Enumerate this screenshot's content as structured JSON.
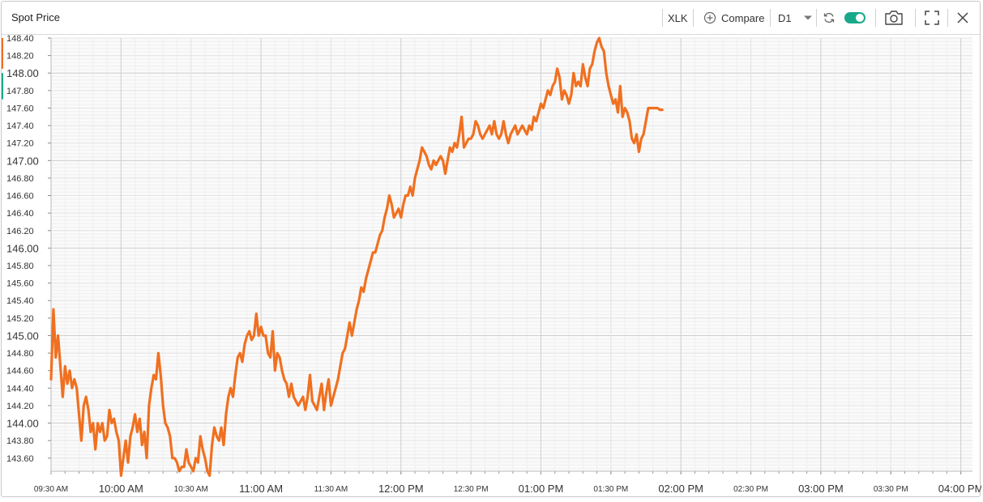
{
  "header": {
    "title": "Spot Price",
    "symbol": "XLK",
    "compare_label": "Compare",
    "timeframe": "D1",
    "toggle_on": true,
    "accent": "#19a98a"
  },
  "chart_data": {
    "type": "line",
    "title": "",
    "xlabel": "",
    "ylabel": "",
    "ylim": [
      143.45,
      148.4
    ],
    "xlim_minutes_from_0930": [
      0,
      395
    ],
    "grid": true,
    "line_color": "#f07020",
    "y_ticks": [
      {
        "v": 143.6,
        "label": "143.60",
        "major": false
      },
      {
        "v": 143.8,
        "label": "143.80",
        "major": false
      },
      {
        "v": 144.0,
        "label": "144.00",
        "major": true
      },
      {
        "v": 144.2,
        "label": "144.20",
        "major": false
      },
      {
        "v": 144.4,
        "label": "144.40",
        "major": false
      },
      {
        "v": 144.6,
        "label": "144.60",
        "major": false
      },
      {
        "v": 144.8,
        "label": "144.80",
        "major": false
      },
      {
        "v": 145.0,
        "label": "145.00",
        "major": true
      },
      {
        "v": 145.2,
        "label": "145.20",
        "major": false
      },
      {
        "v": 145.4,
        "label": "145.40",
        "major": false
      },
      {
        "v": 145.6,
        "label": "145.60",
        "major": false
      },
      {
        "v": 145.8,
        "label": "145.80",
        "major": false
      },
      {
        "v": 146.0,
        "label": "146.00",
        "major": true
      },
      {
        "v": 146.2,
        "label": "146.20",
        "major": false
      },
      {
        "v": 146.4,
        "label": "146.40",
        "major": false
      },
      {
        "v": 146.6,
        "label": "146.60",
        "major": false
      },
      {
        "v": 146.8,
        "label": "146.80",
        "major": false
      },
      {
        "v": 147.0,
        "label": "147.00",
        "major": true
      },
      {
        "v": 147.2,
        "label": "147.20",
        "major": false
      },
      {
        "v": 147.4,
        "label": "147.40",
        "major": false
      },
      {
        "v": 147.6,
        "label": "147.60",
        "major": false
      },
      {
        "v": 147.8,
        "label": "147.80",
        "major": false
      },
      {
        "v": 148.0,
        "label": "148.00",
        "major": true
      },
      {
        "v": 148.2,
        "label": "148.20",
        "major": false
      },
      {
        "v": 148.4,
        "label": "148.40",
        "major": false
      }
    ],
    "x_ticks": [
      {
        "t": 0,
        "label": "09:30 AM",
        "major": false
      },
      {
        "t": 30,
        "label": "10:00 AM",
        "major": true
      },
      {
        "t": 60,
        "label": "10:30 AM",
        "major": false
      },
      {
        "t": 90,
        "label": "11:00 AM",
        "major": true
      },
      {
        "t": 120,
        "label": "11:30 AM",
        "major": false
      },
      {
        "t": 150,
        "label": "12:00 PM",
        "major": true
      },
      {
        "t": 180,
        "label": "12:30 PM",
        "major": false
      },
      {
        "t": 210,
        "label": "01:00 PM",
        "major": true
      },
      {
        "t": 240,
        "label": "01:30 PM",
        "major": false
      },
      {
        "t": 270,
        "label": "02:00 PM",
        "major": true
      },
      {
        "t": 300,
        "label": "02:30 PM",
        "major": false
      },
      {
        "t": 330,
        "label": "03:00 PM",
        "major": true
      },
      {
        "t": 360,
        "label": "03:30 PM",
        "major": false
      },
      {
        "t": 390,
        "label": "04:00 PM",
        "major": true
      }
    ],
    "series": [
      {
        "values": [
          [
            0,
            144.5
          ],
          [
            1,
            145.3
          ],
          [
            2,
            144.75
          ],
          [
            3,
            145.0
          ],
          [
            4,
            144.65
          ],
          [
            5,
            144.3
          ],
          [
            6,
            144.65
          ],
          [
            7,
            144.45
          ],
          [
            8,
            144.6
          ],
          [
            9,
            144.4
          ],
          [
            10,
            144.5
          ],
          [
            11,
            144.4
          ],
          [
            12,
            144.1
          ],
          [
            13,
            143.8
          ],
          [
            14,
            144.2
          ],
          [
            15,
            144.3
          ],
          [
            16,
            144.15
          ],
          [
            17,
            143.9
          ],
          [
            18,
            144.0
          ],
          [
            19,
            143.7
          ],
          [
            20,
            144.0
          ],
          [
            21,
            143.9
          ],
          [
            22,
            144.0
          ],
          [
            23,
            143.8
          ],
          [
            24,
            143.85
          ],
          [
            25,
            144.15
          ],
          [
            26,
            144.0
          ],
          [
            27,
            144.05
          ],
          [
            28,
            143.9
          ],
          [
            29,
            143.8
          ],
          [
            30,
            143.4
          ],
          [
            31,
            143.6
          ],
          [
            32,
            143.8
          ],
          [
            33,
            143.55
          ],
          [
            34,
            143.85
          ],
          [
            35,
            143.95
          ],
          [
            36,
            144.1
          ],
          [
            37,
            143.9
          ],
          [
            38,
            144.05
          ],
          [
            39,
            143.75
          ],
          [
            40,
            143.9
          ],
          [
            41,
            143.6
          ],
          [
            42,
            144.2
          ],
          [
            43,
            144.4
          ],
          [
            44,
            144.55
          ],
          [
            45,
            144.5
          ],
          [
            46,
            144.8
          ],
          [
            47,
            144.55
          ],
          [
            48,
            144.2
          ],
          [
            49,
            144.0
          ],
          [
            50,
            143.95
          ],
          [
            51,
            143.85
          ],
          [
            52,
            143.6
          ],
          [
            53,
            143.6
          ],
          [
            54,
            143.55
          ],
          [
            55,
            143.45
          ],
          [
            56,
            143.5
          ],
          [
            57,
            143.5
          ],
          [
            58,
            143.7
          ],
          [
            59,
            143.55
          ],
          [
            60,
            143.5
          ],
          [
            61,
            143.45
          ],
          [
            62,
            143.6
          ],
          [
            63,
            143.55
          ],
          [
            64,
            143.85
          ],
          [
            65,
            143.7
          ],
          [
            66,
            143.6
          ],
          [
            67,
            143.45
          ],
          [
            68,
            143.4
          ],
          [
            69,
            143.75
          ],
          [
            70,
            143.95
          ],
          [
            71,
            143.85
          ],
          [
            72,
            143.8
          ],
          [
            73,
            143.95
          ],
          [
            74,
            143.75
          ],
          [
            75,
            144.1
          ],
          [
            76,
            144.3
          ],
          [
            77,
            144.4
          ],
          [
            78,
            144.3
          ],
          [
            79,
            144.55
          ],
          [
            80,
            144.75
          ],
          [
            81,
            144.8
          ],
          [
            82,
            144.7
          ],
          [
            83,
            144.9
          ],
          [
            84,
            145.0
          ],
          [
            85,
            145.05
          ],
          [
            86,
            144.95
          ],
          [
            87,
            145.0
          ],
          [
            88,
            145.25
          ],
          [
            89,
            145.0
          ],
          [
            90,
            145.1
          ],
          [
            91,
            145.0
          ],
          [
            92,
            145.0
          ],
          [
            93,
            144.8
          ],
          [
            94,
            144.75
          ],
          [
            95,
            145.05
          ],
          [
            96,
            144.6
          ],
          [
            97,
            144.8
          ],
          [
            98,
            144.75
          ],
          [
            99,
            144.6
          ],
          [
            100,
            144.5
          ],
          [
            101,
            144.45
          ],
          [
            102,
            144.3
          ],
          [
            103,
            144.45
          ],
          [
            104,
            144.3
          ],
          [
            105,
            144.25
          ],
          [
            106,
            144.2
          ],
          [
            107,
            144.25
          ],
          [
            108,
            144.3
          ],
          [
            109,
            144.15
          ],
          [
            110,
            144.3
          ],
          [
            111,
            144.55
          ],
          [
            112,
            144.25
          ],
          [
            113,
            144.2
          ],
          [
            114,
            144.15
          ],
          [
            115,
            144.3
          ],
          [
            116,
            144.45
          ],
          [
            117,
            144.15
          ],
          [
            118,
            144.35
          ],
          [
            119,
            144.5
          ],
          [
            120,
            144.2
          ],
          [
            121,
            144.3
          ],
          [
            122,
            144.4
          ],
          [
            123,
            144.5
          ],
          [
            124,
            144.65
          ],
          [
            125,
            144.8
          ],
          [
            126,
            144.85
          ],
          [
            127,
            145.0
          ],
          [
            128,
            145.15
          ],
          [
            129,
            145.0
          ],
          [
            130,
            145.15
          ],
          [
            131,
            145.3
          ],
          [
            132,
            145.4
          ],
          [
            133,
            145.55
          ],
          [
            134,
            145.5
          ],
          [
            135,
            145.65
          ],
          [
            136,
            145.75
          ],
          [
            137,
            145.85
          ],
          [
            138,
            145.95
          ],
          [
            139,
            145.95
          ],
          [
            140,
            146.05
          ],
          [
            141,
            146.15
          ],
          [
            142,
            146.2
          ],
          [
            143,
            146.35
          ],
          [
            144,
            146.45
          ],
          [
            145,
            146.6
          ],
          [
            146,
            146.5
          ],
          [
            147,
            146.35
          ],
          [
            148,
            146.4
          ],
          [
            149,
            146.45
          ],
          [
            150,
            146.35
          ],
          [
            151,
            146.5
          ],
          [
            152,
            146.6
          ],
          [
            153,
            146.6
          ],
          [
            154,
            146.7
          ],
          [
            155,
            146.6
          ],
          [
            156,
            146.8
          ],
          [
            157,
            146.9
          ],
          [
            158,
            147.0
          ],
          [
            159,
            147.15
          ],
          [
            160,
            147.1
          ],
          [
            161,
            147.05
          ],
          [
            162,
            146.95
          ],
          [
            163,
            146.9
          ],
          [
            164,
            147.0
          ],
          [
            165,
            146.95
          ],
          [
            166,
            147.0
          ],
          [
            167,
            147.05
          ],
          [
            168,
            147.0
          ],
          [
            169,
            146.85
          ],
          [
            170,
            147.0
          ],
          [
            171,
            147.15
          ],
          [
            172,
            147.1
          ],
          [
            173,
            147.2
          ],
          [
            174,
            147.15
          ],
          [
            175,
            147.3
          ],
          [
            176,
            147.5
          ],
          [
            177,
            147.15
          ],
          [
            178,
            147.2
          ],
          [
            179,
            147.25
          ],
          [
            180,
            147.25
          ],
          [
            181,
            147.3
          ],
          [
            182,
            147.45
          ],
          [
            183,
            147.4
          ],
          [
            184,
            147.3
          ],
          [
            185,
            147.25
          ],
          [
            186,
            147.3
          ],
          [
            187,
            147.35
          ],
          [
            188,
            147.4
          ],
          [
            189,
            147.3
          ],
          [
            190,
            147.45
          ],
          [
            191,
            147.3
          ],
          [
            192,
            147.25
          ],
          [
            193,
            147.3
          ],
          [
            194,
            147.45
          ],
          [
            195,
            147.3
          ],
          [
            196,
            147.2
          ],
          [
            197,
            147.3
          ],
          [
            198,
            147.35
          ],
          [
            199,
            147.4
          ],
          [
            200,
            147.3
          ],
          [
            201,
            147.35
          ],
          [
            202,
            147.4
          ],
          [
            203,
            147.35
          ],
          [
            204,
            147.3
          ],
          [
            205,
            147.4
          ],
          [
            206,
            147.35
          ],
          [
            207,
            147.5
          ],
          [
            208,
            147.45
          ],
          [
            209,
            147.55
          ],
          [
            210,
            147.65
          ],
          [
            211,
            147.6
          ],
          [
            212,
            147.7
          ],
          [
            213,
            147.8
          ],
          [
            214,
            147.75
          ],
          [
            215,
            147.85
          ],
          [
            216,
            147.9
          ],
          [
            217,
            148.05
          ],
          [
            218,
            147.95
          ],
          [
            219,
            147.7
          ],
          [
            220,
            147.8
          ],
          [
            221,
            147.75
          ],
          [
            222,
            147.65
          ],
          [
            223,
            147.75
          ],
          [
            224,
            148.0
          ],
          [
            225,
            147.85
          ],
          [
            226,
            147.9
          ],
          [
            227,
            147.85
          ],
          [
            228,
            148.1
          ],
          [
            229,
            147.95
          ],
          [
            230,
            147.85
          ],
          [
            231,
            148.05
          ],
          [
            232,
            148.1
          ],
          [
            233,
            148.25
          ],
          [
            234,
            148.35
          ],
          [
            235,
            148.4
          ],
          [
            236,
            148.3
          ],
          [
            237,
            148.25
          ],
          [
            238,
            148.0
          ],
          [
            239,
            147.85
          ],
          [
            240,
            147.75
          ],
          [
            241,
            147.65
          ],
          [
            242,
            147.7
          ],
          [
            243,
            147.55
          ],
          [
            244,
            147.85
          ],
          [
            245,
            147.5
          ],
          [
            246,
            147.6
          ],
          [
            247,
            147.55
          ],
          [
            248,
            147.45
          ],
          [
            249,
            147.25
          ],
          [
            250,
            147.2
          ],
          [
            251,
            147.3
          ],
          [
            252,
            147.1
          ],
          [
            253,
            147.25
          ],
          [
            254,
            147.3
          ],
          [
            255,
            147.45
          ],
          [
            256,
            147.6
          ],
          [
            257,
            147.6
          ],
          [
            258,
            147.6
          ],
          [
            259,
            147.6
          ],
          [
            260,
            147.6
          ],
          [
            261,
            147.58
          ],
          [
            262,
            147.58
          ]
        ]
      }
    ]
  }
}
